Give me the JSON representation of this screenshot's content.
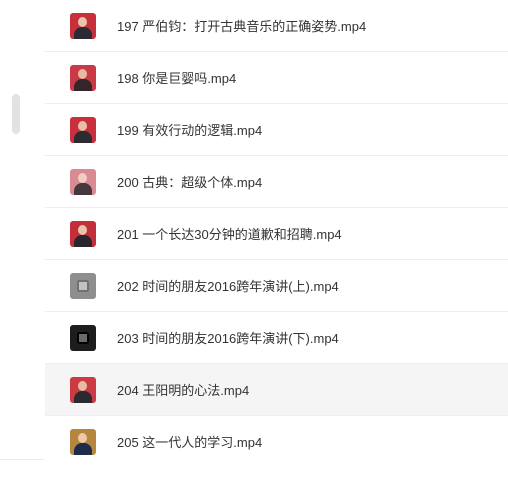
{
  "files": [
    {
      "name": "197 严伯钧：打开古典音乐的正确姿势.mp4",
      "thumb": "portrait",
      "colors": [
        "#c7303a",
        "#e9c3aa",
        "#2a2a35"
      ]
    },
    {
      "name": "198 你是巨婴吗.mp4",
      "thumb": "portrait",
      "colors": [
        "#c93a46",
        "#e6b9a3",
        "#33262a"
      ]
    },
    {
      "name": "199 有效行动的逻辑.mp4",
      "thumb": "portrait",
      "colors": [
        "#c9303d",
        "#e8bfa6",
        "#2b2b30"
      ]
    },
    {
      "name": "200 古典：超级个体.mp4",
      "thumb": "portrait",
      "colors": [
        "#d98a92",
        "#f0cfc0",
        "#45383c"
      ]
    },
    {
      "name": "201 一个长达30分钟的道歉和招聘.mp4",
      "thumb": "portrait",
      "colors": [
        "#c22e3a",
        "#e9c3aa",
        "#26262c"
      ]
    },
    {
      "name": "202 时间的朋友2016跨年演讲(上).mp4",
      "thumb": "screen",
      "colors": [
        "#8e8e8e",
        "#c2c2c2",
        "#707070"
      ]
    },
    {
      "name": "203 时间的朋友2016跨年演讲(下).mp4",
      "thumb": "screen",
      "colors": [
        "#1d1d1d",
        "#6a6a6a",
        "#000000"
      ]
    },
    {
      "name": "204 王阳明的心法.mp4",
      "thumb": "portrait",
      "colors": [
        "#cc3a44",
        "#e6bca5",
        "#2c2a30"
      ]
    },
    {
      "name": "205 这一代人的学习.mp4",
      "thumb": "portrait",
      "colors": [
        "#b5863e",
        "#ecc9a8",
        "#1e2c4c"
      ]
    }
  ],
  "hovered_index": 7
}
